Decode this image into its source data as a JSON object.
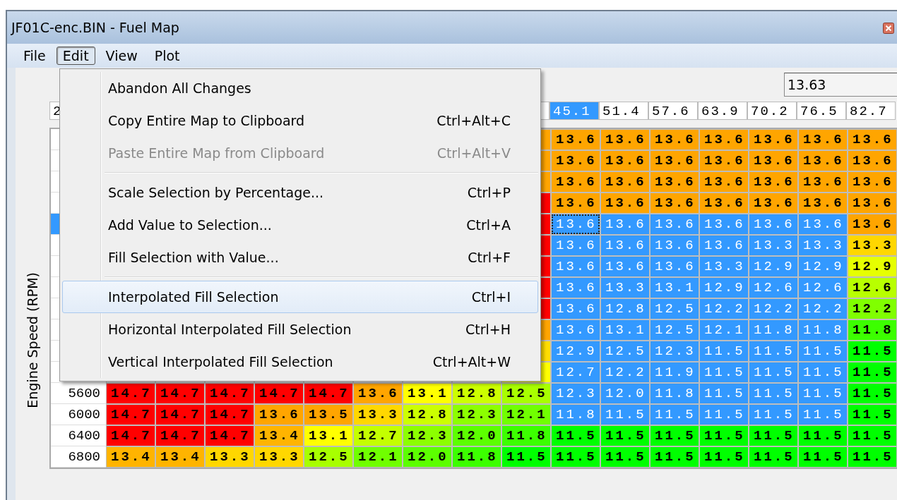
{
  "window": {
    "title": "JF01C-enc.BIN - Fuel Map"
  },
  "menu_bar": [
    {
      "label": "File",
      "selected": false
    },
    {
      "label": "Edit",
      "selected": true
    },
    {
      "label": "View",
      "selected": false
    },
    {
      "label": "Plot",
      "selected": false
    }
  ],
  "edit_menu": {
    "sections": [
      {
        "items": [
          {
            "label": "Abandon All Changes",
            "disabled": false,
            "highlighted": false
          },
          {
            "label": "Copy Entire Map to Clipboard",
            "shortcut": "Ctrl+Alt+C",
            "disabled": false,
            "highlighted": false
          },
          {
            "label": "Paste Entire Map from Clipboard",
            "shortcut": "Ctrl+Alt+V",
            "disabled": true,
            "highlighted": false
          }
        ]
      },
      {
        "items": [
          {
            "label": "Scale Selection by Percentage...",
            "shortcut": "Ctrl+P",
            "disabled": false,
            "highlighted": false
          },
          {
            "label": "Add Value to Selection...",
            "shortcut": "Ctrl+A",
            "disabled": false,
            "highlighted": false
          },
          {
            "label": "Fill Selection with Value...",
            "shortcut": "Ctrl+F",
            "disabled": false,
            "highlighted": false
          }
        ]
      },
      {
        "items": [
          {
            "label": "Interpolated Fill Selection",
            "shortcut": "Ctrl+I",
            "disabled": false,
            "highlighted": true
          },
          {
            "label": "Horizontal Interpolated Fill Selection",
            "shortcut": "Ctrl+H",
            "disabled": false,
            "highlighted": false
          },
          {
            "label": "Vertical Interpolated Fill Selection",
            "shortcut": "Ctrl+Alt+W",
            "disabled": false,
            "highlighted": false
          }
        ]
      }
    ]
  },
  "value_field": {
    "value": "13.63"
  },
  "map": {
    "y_axis_label": "Engine Speed (RPM)",
    "corner": "2",
    "columns": [
      null,
      null,
      null,
      null,
      null,
      null,
      null,
      null,
      {
        "selected": false
      },
      {
        "label": "45.1",
        "selected": true
      },
      {
        "label": "51.4",
        "selected": false
      },
      {
        "label": "57.6",
        "selected": false
      },
      {
        "label": "63.9",
        "selected": false
      },
      {
        "label": "70.2",
        "selected": false
      },
      {
        "label": "76.5",
        "selected": false
      },
      {
        "label": "82.7",
        "selected": false
      }
    ],
    "rows": [
      {
        "selected": false,
        "cells": [
          null,
          null,
          null,
          null,
          null,
          null,
          null,
          null,
          {
            "color": "#ffa500",
            "selected": false,
            "focused": false
          },
          {
            "value": "13.6",
            "color": "#ffa500",
            "selected": false,
            "focused": false
          },
          {
            "value": "13.6",
            "color": "#ffa500",
            "selected": false,
            "focused": false
          },
          {
            "value": "13.6",
            "color": "#ffa500",
            "selected": false,
            "focused": false
          },
          {
            "value": "13.6",
            "color": "#ffa500",
            "selected": false,
            "focused": false
          },
          {
            "value": "13.6",
            "color": "#ffa500",
            "selected": false,
            "focused": false
          },
          {
            "value": "13.6",
            "color": "#ffa500",
            "selected": false,
            "focused": false
          },
          {
            "value": "13.6",
            "color": "#ffa500",
            "selected": false,
            "focused": false
          }
        ]
      },
      {
        "selected": false,
        "cells": [
          null,
          null,
          null,
          null,
          null,
          null,
          null,
          null,
          {
            "color": "#ffa500",
            "selected": false,
            "focused": false
          },
          {
            "value": "13.6",
            "color": "#ffa500",
            "selected": false,
            "focused": false
          },
          {
            "value": "13.6",
            "color": "#ffa500",
            "selected": false,
            "focused": false
          },
          {
            "value": "13.6",
            "color": "#ffa500",
            "selected": false,
            "focused": false
          },
          {
            "value": "13.6",
            "color": "#ffa500",
            "selected": false,
            "focused": false
          },
          {
            "value": "13.6",
            "color": "#ffa500",
            "selected": false,
            "focused": false
          },
          {
            "value": "13.6",
            "color": "#ffa500",
            "selected": false,
            "focused": false
          },
          {
            "value": "13.6",
            "color": "#ffa500",
            "selected": false,
            "focused": false
          }
        ]
      },
      {
        "selected": false,
        "cells": [
          null,
          null,
          null,
          null,
          null,
          null,
          null,
          null,
          {
            "color": "#ffa500",
            "selected": false,
            "focused": false
          },
          {
            "value": "13.6",
            "color": "#ffa500",
            "selected": false,
            "focused": false
          },
          {
            "value": "13.6",
            "color": "#ffa500",
            "selected": false,
            "focused": false
          },
          {
            "value": "13.6",
            "color": "#ffa500",
            "selected": false,
            "focused": false
          },
          {
            "value": "13.6",
            "color": "#ffa500",
            "selected": false,
            "focused": false
          },
          {
            "value": "13.6",
            "color": "#ffa500",
            "selected": false,
            "focused": false
          },
          {
            "value": "13.6",
            "color": "#ffa500",
            "selected": false,
            "focused": false
          },
          {
            "value": "13.6",
            "color": "#ffa500",
            "selected": false,
            "focused": false
          }
        ]
      },
      {
        "selected": false,
        "cells": [
          null,
          null,
          null,
          null,
          null,
          null,
          null,
          null,
          {
            "color": "#ff0000",
            "selected": false,
            "focused": false
          },
          {
            "value": "13.6",
            "color": "#ffa500",
            "selected": false,
            "focused": false
          },
          {
            "value": "13.6",
            "color": "#ffa500",
            "selected": false,
            "focused": false
          },
          {
            "value": "13.6",
            "color": "#ffa500",
            "selected": false,
            "focused": false
          },
          {
            "value": "13.6",
            "color": "#ffa500",
            "selected": false,
            "focused": false
          },
          {
            "value": "13.6",
            "color": "#ffa500",
            "selected": false,
            "focused": false
          },
          {
            "value": "13.6",
            "color": "#ffa500",
            "selected": false,
            "focused": false
          },
          {
            "value": "13.6",
            "color": "#ffa500",
            "selected": false,
            "focused": false
          }
        ]
      },
      {
        "selected": true,
        "cells": [
          null,
          null,
          null,
          null,
          null,
          null,
          null,
          null,
          {
            "color": "#ff0000",
            "selected": false,
            "focused": false
          },
          {
            "value": "13.6",
            "selected": true,
            "focused": true
          },
          {
            "value": "13.6",
            "selected": true,
            "focused": false
          },
          {
            "value": "13.6",
            "selected": true,
            "focused": false
          },
          {
            "value": "13.6",
            "selected": true,
            "focused": false
          },
          {
            "value": "13.6",
            "selected": true,
            "focused": false
          },
          {
            "value": "13.6",
            "selected": true,
            "focused": false
          },
          {
            "value": "13.6",
            "color": "#ffa500",
            "selected": false,
            "focused": false
          }
        ]
      },
      {
        "selected": false,
        "cells": [
          null,
          null,
          null,
          null,
          null,
          null,
          null,
          null,
          {
            "color": "#ff0000",
            "selected": false,
            "focused": false
          },
          {
            "value": "13.6",
            "selected": true,
            "focused": false
          },
          {
            "value": "13.6",
            "selected": true,
            "focused": false
          },
          {
            "value": "13.6",
            "selected": true,
            "focused": false
          },
          {
            "value": "13.6",
            "selected": true,
            "focused": false
          },
          {
            "value": "13.3",
            "selected": true,
            "focused": false
          },
          {
            "value": "13.3",
            "selected": true,
            "focused": false
          },
          {
            "value": "13.3",
            "color": "#ffd700",
            "selected": false,
            "focused": false
          }
        ]
      },
      {
        "selected": false,
        "cells": [
          null,
          null,
          null,
          null,
          null,
          null,
          null,
          null,
          {
            "color": "#ff0000",
            "selected": false,
            "focused": false
          },
          {
            "value": "13.6",
            "selected": true,
            "focused": false
          },
          {
            "value": "13.6",
            "selected": true,
            "focused": false
          },
          {
            "value": "13.6",
            "selected": true,
            "focused": false
          },
          {
            "value": "13.3",
            "selected": true,
            "focused": false
          },
          {
            "value": "12.9",
            "selected": true,
            "focused": false
          },
          {
            "value": "12.9",
            "selected": true,
            "focused": false
          },
          {
            "value": "12.9",
            "color": "#e6ff00",
            "selected": false,
            "focused": false
          }
        ]
      },
      {
        "selected": false,
        "cells": [
          null,
          null,
          null,
          null,
          null,
          null,
          null,
          null,
          {
            "color": "#ff0000",
            "selected": false,
            "focused": false
          },
          {
            "value": "13.6",
            "selected": true,
            "focused": false
          },
          {
            "value": "13.3",
            "selected": true,
            "focused": false
          },
          {
            "value": "13.1",
            "selected": true,
            "focused": false
          },
          {
            "value": "12.9",
            "selected": true,
            "focused": false
          },
          {
            "value": "12.6",
            "selected": true,
            "focused": false
          },
          {
            "value": "12.6",
            "selected": true,
            "focused": false
          },
          {
            "value": "12.6",
            "color": "#b8ff00",
            "selected": false,
            "focused": false
          }
        ]
      },
      {
        "selected": false,
        "cells": [
          null,
          null,
          null,
          null,
          null,
          null,
          null,
          null,
          {
            "color": "#ff0000",
            "selected": false,
            "focused": false
          },
          {
            "value": "13.6",
            "selected": true,
            "focused": false
          },
          {
            "value": "12.8",
            "selected": true,
            "focused": false
          },
          {
            "value": "12.5",
            "selected": true,
            "focused": false
          },
          {
            "value": "12.2",
            "selected": true,
            "focused": false
          },
          {
            "value": "12.2",
            "selected": true,
            "focused": false
          },
          {
            "value": "12.2",
            "selected": true,
            "focused": false
          },
          {
            "value": "12.2",
            "color": "#80ff00",
            "selected": false,
            "focused": false
          }
        ]
      },
      {
        "selected": false,
        "cells": [
          null,
          null,
          null,
          null,
          null,
          null,
          null,
          null,
          {
            "color": "#ffa500",
            "selected": false,
            "focused": false
          },
          {
            "value": "13.6",
            "selected": true,
            "focused": false
          },
          {
            "value": "13.1",
            "selected": true,
            "focused": false
          },
          {
            "value": "12.5",
            "selected": true,
            "focused": false
          },
          {
            "value": "12.1",
            "selected": true,
            "focused": false
          },
          {
            "value": "11.8",
            "selected": true,
            "focused": false
          },
          {
            "value": "11.8",
            "selected": true,
            "focused": false
          },
          {
            "value": "11.8",
            "color": "#3cff00",
            "selected": false,
            "focused": false
          }
        ]
      },
      {
        "selected": false,
        "cells": [
          null,
          null,
          null,
          null,
          null,
          null,
          null,
          null,
          {
            "color": "#ffdd00",
            "selected": false,
            "focused": false
          },
          {
            "value": "12.9",
            "selected": true,
            "focused": false
          },
          {
            "value": "12.5",
            "selected": true,
            "focused": false
          },
          {
            "value": "12.3",
            "selected": true,
            "focused": false
          },
          {
            "value": "11.5",
            "selected": true,
            "focused": false
          },
          {
            "value": "11.5",
            "selected": true,
            "focused": false
          },
          {
            "value": "11.5",
            "selected": true,
            "focused": false
          },
          {
            "value": "11.5",
            "color": "#00ff00",
            "selected": false,
            "focused": false
          }
        ]
      },
      {
        "selected": false,
        "cells": [
          null,
          null,
          null,
          null,
          null,
          null,
          null,
          null,
          {
            "color": "#ffff00",
            "selected": false,
            "focused": false
          },
          {
            "value": "12.7",
            "selected": true,
            "focused": false
          },
          {
            "value": "12.2",
            "selected": true,
            "focused": false
          },
          {
            "value": "11.9",
            "selected": true,
            "focused": false
          },
          {
            "value": "11.5",
            "selected": true,
            "focused": false
          },
          {
            "value": "11.5",
            "selected": true,
            "focused": false
          },
          {
            "value": "11.5",
            "selected": true,
            "focused": false
          },
          {
            "value": "11.5",
            "color": "#00ff00",
            "selected": false,
            "focused": false
          }
        ]
      },
      {
        "label": "5600",
        "selected": false,
        "cells": [
          {
            "value": "14.7",
            "color": "#ff0000",
            "selected": false,
            "focused": false
          },
          {
            "value": "14.7",
            "color": "#ff0000",
            "selected": false,
            "focused": false
          },
          {
            "value": "14.7",
            "color": "#ff0000",
            "selected": false,
            "focused": false
          },
          {
            "value": "14.7",
            "color": "#ff0000",
            "selected": false,
            "focused": false
          },
          {
            "value": "14.7",
            "color": "#ff0000",
            "selected": false,
            "focused": false
          },
          {
            "value": "13.6",
            "color": "#ffa500",
            "selected": false,
            "focused": false
          },
          {
            "value": "13.1",
            "color": "#ffff00",
            "selected": false,
            "focused": false
          },
          {
            "value": "12.8",
            "color": "#ccff00",
            "selected": false,
            "focused": false
          },
          {
            "value": "12.5",
            "color": "#a8ff00",
            "selected": false,
            "focused": false
          },
          {
            "value": "12.3",
            "selected": true,
            "focused": false
          },
          {
            "value": "12.0",
            "selected": true,
            "focused": false
          },
          {
            "value": "11.8",
            "selected": true,
            "focused": false
          },
          {
            "value": "11.5",
            "selected": true,
            "focused": false
          },
          {
            "value": "11.5",
            "selected": true,
            "focused": false
          },
          {
            "value": "11.5",
            "selected": true,
            "focused": false
          },
          {
            "value": "11.5",
            "color": "#00ff00",
            "selected": false,
            "focused": false
          }
        ]
      },
      {
        "label": "6000",
        "selected": false,
        "cells": [
          {
            "value": "14.7",
            "color": "#ff0000",
            "selected": false,
            "focused": false
          },
          {
            "value": "14.7",
            "color": "#ff0000",
            "selected": false,
            "focused": false
          },
          {
            "value": "14.7",
            "color": "#ff0000",
            "selected": false,
            "focused": false
          },
          {
            "value": "13.6",
            "color": "#ffa500",
            "selected": false,
            "focused": false
          },
          {
            "value": "13.5",
            "color": "#ffa500",
            "selected": false,
            "focused": false
          },
          {
            "value": "13.3",
            "color": "#ffd700",
            "selected": false,
            "focused": false
          },
          {
            "value": "12.8",
            "color": "#ccff00",
            "selected": false,
            "focused": false
          },
          {
            "value": "12.3",
            "color": "#8cff00",
            "selected": false,
            "focused": false
          },
          {
            "value": "12.1",
            "color": "#70ff00",
            "selected": false,
            "focused": false
          },
          {
            "value": "11.8",
            "selected": true,
            "focused": false
          },
          {
            "value": "11.5",
            "selected": true,
            "focused": false
          },
          {
            "value": "11.5",
            "selected": true,
            "focused": false
          },
          {
            "value": "11.5",
            "selected": true,
            "focused": false
          },
          {
            "value": "11.5",
            "selected": true,
            "focused": false
          },
          {
            "value": "11.5",
            "selected": true,
            "focused": false
          },
          {
            "value": "11.5",
            "color": "#00ff00",
            "selected": false,
            "focused": false
          }
        ]
      },
      {
        "label": "6400",
        "selected": false,
        "cells": [
          {
            "value": "14.7",
            "color": "#ff0000",
            "selected": false,
            "focused": false
          },
          {
            "value": "14.7",
            "color": "#ff0000",
            "selected": false,
            "focused": false
          },
          {
            "value": "14.7",
            "color": "#ff0000",
            "selected": false,
            "focused": false
          },
          {
            "value": "13.4",
            "color": "#ffb400",
            "selected": false,
            "focused": false
          },
          {
            "value": "13.1",
            "color": "#ffff00",
            "selected": false,
            "focused": false
          },
          {
            "value": "12.7",
            "color": "#c4ff00",
            "selected": false,
            "focused": false
          },
          {
            "value": "12.3",
            "color": "#8cff00",
            "selected": false,
            "focused": false
          },
          {
            "value": "12.0",
            "color": "#5cff00",
            "selected": false,
            "focused": false
          },
          {
            "value": "11.8",
            "color": "#3cff00",
            "selected": false,
            "focused": false
          },
          {
            "value": "11.5",
            "color": "#00ff00",
            "selected": false,
            "focused": false
          },
          {
            "value": "11.5",
            "color": "#00ff00",
            "selected": false,
            "focused": false
          },
          {
            "value": "11.5",
            "color": "#00ff00",
            "selected": false,
            "focused": false
          },
          {
            "value": "11.5",
            "color": "#00ff00",
            "selected": false,
            "focused": false
          },
          {
            "value": "11.5",
            "color": "#00ff00",
            "selected": false,
            "focused": false
          },
          {
            "value": "11.5",
            "color": "#00ff00",
            "selected": false,
            "focused": false
          },
          {
            "value": "11.5",
            "color": "#00ff00",
            "selected": false,
            "focused": false
          }
        ]
      },
      {
        "label": "6800",
        "selected": false,
        "cells": [
          {
            "value": "13.4",
            "color": "#ffb400",
            "selected": false,
            "focused": false
          },
          {
            "value": "13.4",
            "color": "#ffb400",
            "selected": false,
            "focused": false
          },
          {
            "value": "13.3",
            "color": "#ffd700",
            "selected": false,
            "focused": false
          },
          {
            "value": "13.3",
            "color": "#ffd700",
            "selected": false,
            "focused": false
          },
          {
            "value": "12.5",
            "color": "#a8ff00",
            "selected": false,
            "focused": false
          },
          {
            "value": "12.1",
            "color": "#70ff00",
            "selected": false,
            "focused": false
          },
          {
            "value": "12.0",
            "color": "#5cff00",
            "selected": false,
            "focused": false
          },
          {
            "value": "11.8",
            "color": "#3cff00",
            "selected": false,
            "focused": false
          },
          {
            "value": "11.5",
            "color": "#00ff00",
            "selected": false,
            "focused": false
          },
          {
            "value": "11.5",
            "color": "#00ff00",
            "selected": false,
            "focused": false
          },
          {
            "value": "11.5",
            "color": "#00ff00",
            "selected": false,
            "focused": false
          },
          {
            "value": "11.5",
            "color": "#00ff00",
            "selected": false,
            "focused": false
          },
          {
            "value": "11.5",
            "color": "#00ff00",
            "selected": false,
            "focused": false
          },
          {
            "value": "11.5",
            "color": "#00ff00",
            "selected": false,
            "focused": false
          },
          {
            "value": "11.5",
            "color": "#00ff00",
            "selected": false,
            "focused": false
          },
          {
            "value": "11.5",
            "color": "#00ff00",
            "selected": false,
            "focused": false
          }
        ]
      }
    ]
  }
}
